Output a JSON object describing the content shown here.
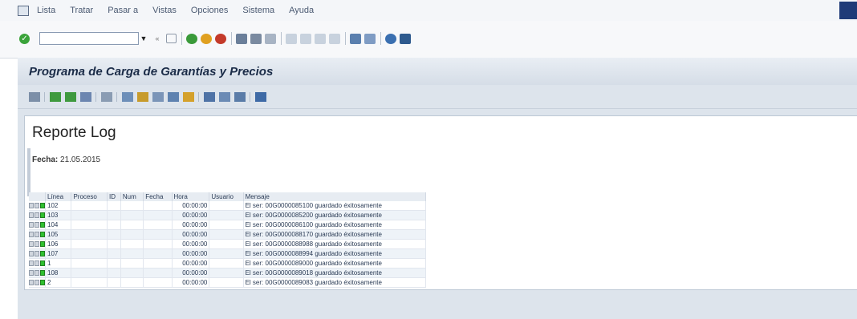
{
  "menu": {
    "items": [
      "Lista",
      "Tratar",
      "Pasar a",
      "Vistas",
      "Opciones",
      "Sistema",
      "Ayuda"
    ]
  },
  "toolbar": {
    "command_value": ""
  },
  "title": "Programa de Carga de Garantías y Precios",
  "report": {
    "heading": "Reporte Log",
    "fecha_label": "Fecha:",
    "fecha_value": "21.05.2015"
  },
  "table": {
    "columns": [
      "Línea",
      "Proceso",
      "ID",
      "Num",
      "Fecha",
      "Hora",
      "Usuario",
      "Mensaje"
    ],
    "rows": [
      {
        "linea": "102",
        "hora": "00:00:00",
        "mensaje": "El ser: 00G0000085100 guardado éxitosamente"
      },
      {
        "linea": "103",
        "hora": "00:00:00",
        "mensaje": "El ser: 00G0000085200 guardado éxitosamente"
      },
      {
        "linea": "104",
        "hora": "00:00:00",
        "mensaje": "El ser: 00G0000086100 guardado éxitosamente"
      },
      {
        "linea": "105",
        "hora": "00:00:00",
        "mensaje": "El ser: 00G0000088170 guardado éxitosamente"
      },
      {
        "linea": "106",
        "hora": "00:00:00",
        "mensaje": "El ser: 00G0000088988 guardado éxitosamente"
      },
      {
        "linea": "107",
        "hora": "00:00:00",
        "mensaje": "El ser: 00G0000088994 guardado éxitosamente"
      },
      {
        "linea": "1",
        "hora": "00:00:00",
        "mensaje": "El ser: 00G0000089000 guardado éxitosamente"
      },
      {
        "linea": "108",
        "hora": "00:00:00",
        "mensaje": "El ser: 00G0000089018 guardado éxitosamente"
      },
      {
        "linea": "2",
        "hora": "00:00:00",
        "mensaje": "El ser: 00G0000089083 guardado éxitosamente"
      }
    ]
  },
  "colors": {
    "title_text": "#1b2c48",
    "status_green": "#2fbf2f",
    "app_bg": "#dde4ec"
  }
}
